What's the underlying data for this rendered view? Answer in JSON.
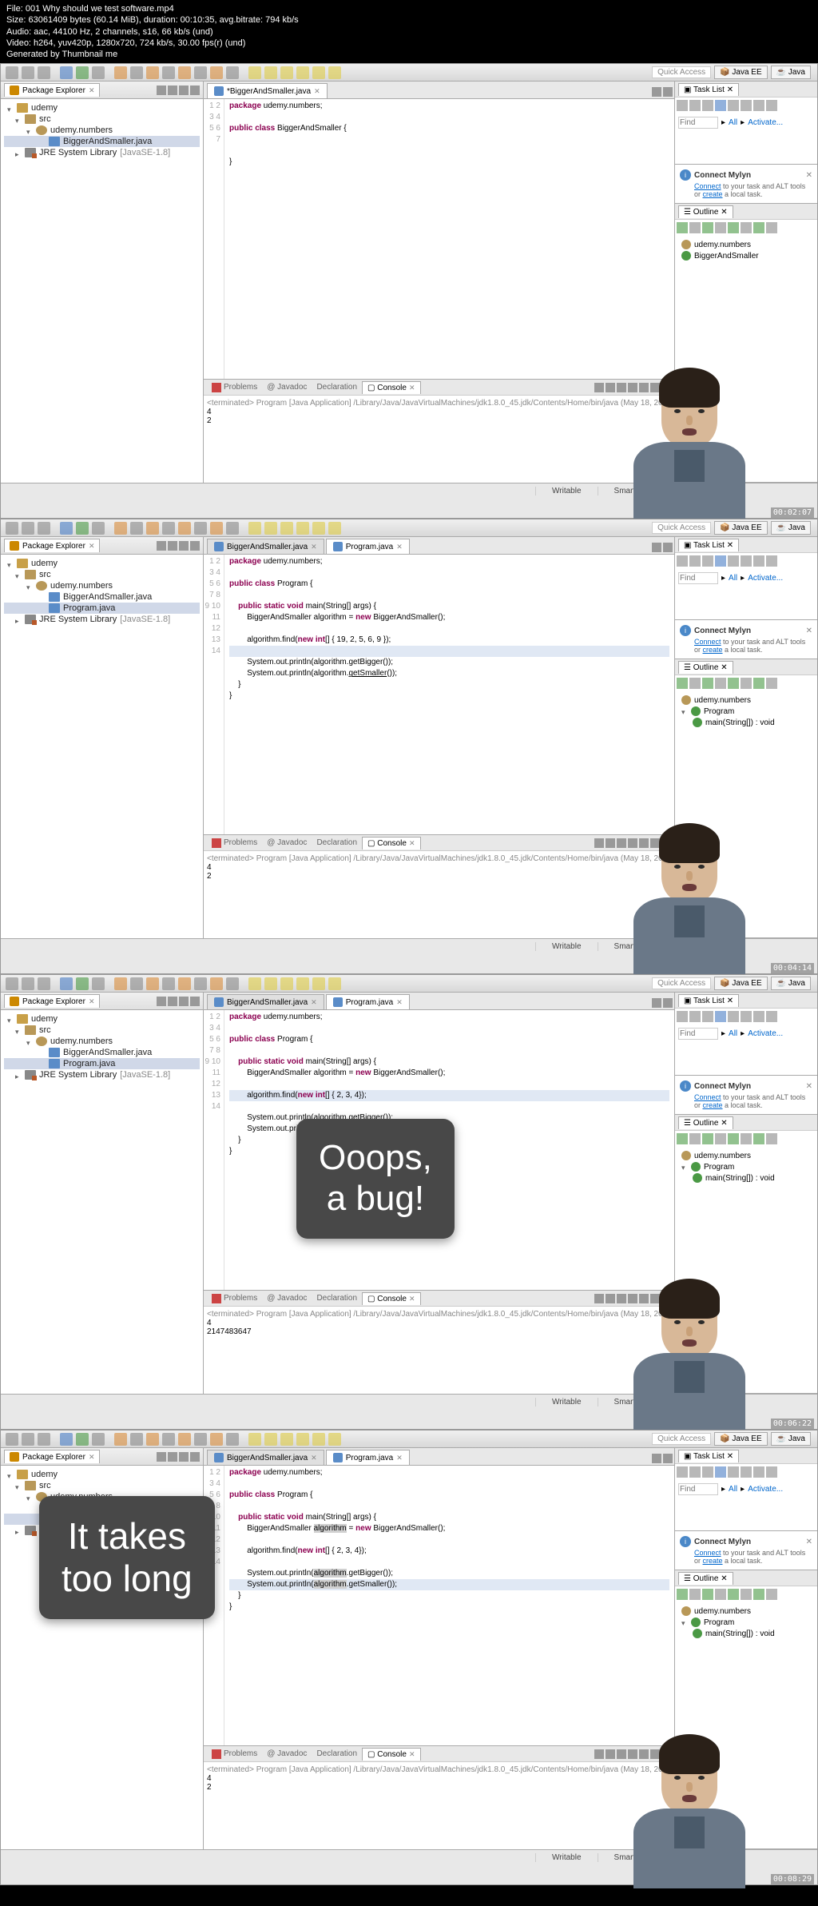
{
  "topinfo": {
    "file": "File: 001 Why should we test software.mp4",
    "size": "Size: 63061409 bytes (60.14 MiB), duration: 00:10:35, avg.bitrate: 794 kb/s",
    "audio": "Audio: aac, 44100 Hz, 2 channels, s16, 66 kb/s (und)",
    "video": "Video: h264, yuv420p, 1280x720, 724 kb/s, 30.00 fps(r) (und)",
    "gen": "Generated by Thumbnail me"
  },
  "common": {
    "quickAccess": "Quick Access",
    "perspJavaEE": "Java EE",
    "perspJava": "Java",
    "pkgExplorer": "Package Explorer",
    "taskList": "Task List",
    "outline": "Outline",
    "problems": "Problems",
    "javadoc": "Javadoc",
    "declaration": "Declaration",
    "console": "Console",
    "writable": "Writable",
    "smartInsert": "Smart Insert",
    "find": "Find",
    "all": "All",
    "activate": "Activate...",
    "connectMylyn": "Connect Mylyn",
    "mylynText1": "Connect",
    "mylynText2": " to your task and ALT tools or ",
    "mylynText3": "create",
    "mylynText4": " a local task."
  },
  "tree": {
    "udemy": "udemy",
    "src": "src",
    "pkg": "udemy.numbers",
    "file1": "BiggerAndSmaller.java",
    "file2": "Program.java",
    "jre": "JRE System Library",
    "jreVer": " [JavaSE-1.8]"
  },
  "outlineData": {
    "pkg": "udemy.numbers",
    "cls1": "BiggerAndSmaller",
    "cls2": "Program",
    "meth": "main(String[]) : void"
  },
  "frames": [
    {
      "tabs": [
        {
          "name": "*BiggerAndSmaller.java",
          "active": true
        }
      ],
      "gutter": "1\n2\n3\n4\n5\n6\n7",
      "code": "<span class='kw'>package</span> udemy.numbers;\n\n<span class='kw'>public class</span> BiggerAndSmaller {\n\n\n}\n",
      "consoleTerm": "<terminated> Program [Java Application] /Library/Java/JavaVirtualMachines/jdk1.8.0_45.jdk/Contents/Home/bin/java (May 18, 20",
      "consoleOut": "4\n2",
      "outlineMode": "BiggerAndSmaller",
      "treeFiles": 1,
      "timestamp": "00:02:07",
      "popup": null
    },
    {
      "tabs": [
        {
          "name": "BiggerAndSmaller.java",
          "active": false
        },
        {
          "name": "Program.java",
          "active": true
        }
      ],
      "gutter": "1\n2\n3\n4\n5\n6\n7\n8\n9\n10\n11\n12\n13\n14",
      "code": "<span class='kw'>package</span> udemy.numbers;\n\n<span class='kw'>public class</span> Program {\n\n    <span class='kw'>public static void</span> main(String[] args) {\n        BiggerAndSmaller algorithm = <span class='kw'>new</span> BiggerAndSmaller();\n\n        algorithm.find(<span class='kw'>new int</span>[] { 19, 2, 5, 6, 9 });\n<span class='hl'>        </span>\n        System.out.println(algorithm.getBigger());\n        System.out.println(algorithm.<u>getSmaller</u>());\n    }\n}\n",
      "consoleTerm": "<terminated> Program [Java Application] /Library/Java/JavaVirtualMachines/jdk1.8.0_45.jdk/Contents/Home/bin/java (May 18, 20",
      "consoleOut": "4\n2",
      "outlineMode": "Program",
      "treeFiles": 2,
      "timestamp": "00:04:14",
      "popup": null
    },
    {
      "tabs": [
        {
          "name": "BiggerAndSmaller.java",
          "active": false
        },
        {
          "name": "Program.java",
          "active": true
        }
      ],
      "gutter": "1\n2\n3\n4\n5\n6\n7\n8\n9\n10\n11\n12\n13\n14",
      "code": "<span class='kw'>package</span> udemy.numbers;\n\n<span class='kw'>public class</span> Program {\n\n    <span class='kw'>public static void</span> main(String[] args) {\n        BiggerAndSmaller algorithm = <span class='kw'>new</span> BiggerAndSmaller();\n\n<span class='hl'>        algorithm.find(<span class='kw'>new int</span>[] { 2, 3, 4});</span>\n\n        System.out.println(algorithm.getBigger());\n        System.out.println(algorithm.getSmaller());\n    }\n}\n",
      "consoleTerm": "<terminated> Program [Java Application] /Library/Java/JavaVirtualMachines/jdk1.8.0_45.jdk/Contents/Home/bin/java (May 18, 20",
      "consoleOut": "4\n2147483647",
      "outlineMode": "Program",
      "treeFiles": 2,
      "timestamp": "00:06:22",
      "popup": {
        "text": "Ooops,\na bug!",
        "class": "bug"
      }
    },
    {
      "tabs": [
        {
          "name": "BiggerAndSmaller.java",
          "active": false
        },
        {
          "name": "Program.java",
          "active": true
        }
      ],
      "gutter": "1\n2\n3\n4\n5\n6\n7\n8\n9\n10\n11\n12\n13\n14",
      "code": "<span class='kw'>package</span> udemy.numbers;\n\n<span class='kw'>public class</span> Program {\n\n    <span class='kw'>public static void</span> main(String[] args) {\n        BiggerAndSmaller <span style='background:#d0d0d0'>algorithm</span> = <span class='kw'>new</span> BiggerAndSmaller();\n\n        algorithm.find(<span class='kw'>new int</span>[] { 2, 3, 4});\n\n        System.out.println(<span style='background:#d0d0d0'>algorithm</span>.getBigger());\n<span class='hl'>        System.out.println(<span style='background:#d0d0d0'>algorithm</span>.getSmaller());</span>\n    }\n}\n",
      "consoleTerm": "<terminated> Program [Java Application] /Library/Java/JavaVirtualMachines/jdk1.8.0_45.jdk/Contents/Home/bin/java (May 18, 20",
      "consoleOut": "4\n2",
      "outlineMode": "Program",
      "treeFiles": 2,
      "timestamp": "00:08:29",
      "popup": {
        "text": "It takes\ntoo long",
        "class": "long"
      }
    }
  ]
}
